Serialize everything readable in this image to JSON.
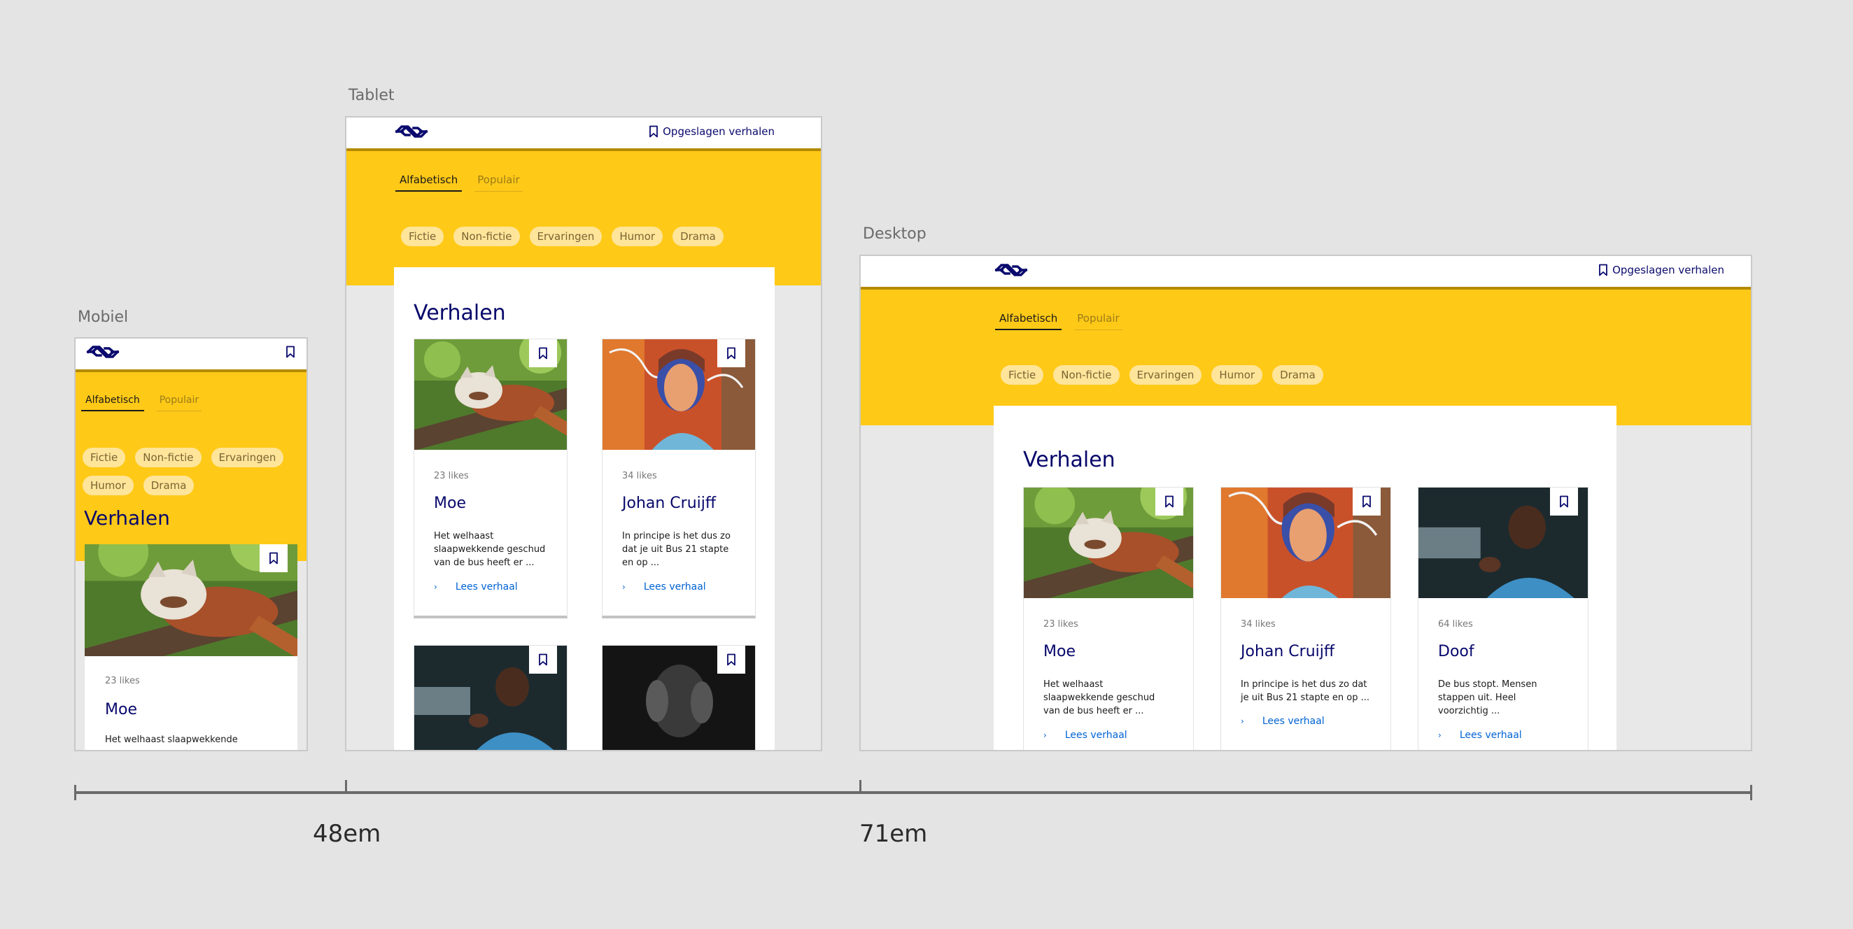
{
  "frames": {
    "mobile": {
      "label": "Mobiel"
    },
    "tablet": {
      "label": "Tablet"
    },
    "desktop": {
      "label": "Desktop"
    }
  },
  "header": {
    "saved_label": "Opgeslagen verhalen"
  },
  "tabs": {
    "alphabetical": "Alfabetisch",
    "popular": "Populair"
  },
  "filters": [
    "Fictie",
    "Non-fictie",
    "Ervaringen",
    "Humor",
    "Drama"
  ],
  "heading": "Verhalen",
  "stories": [
    {
      "likes": "23 likes",
      "title": "Moe",
      "excerpt": "Het welhaast slaapwekkende geschud van de bus heeft er ...",
      "image": "red panda sleeping on a branch"
    },
    {
      "likes": "34 likes",
      "title": "Johan Cruijff",
      "excerpt": "In principe is het dus zo dat je uit Bus 21 stapte en op ...",
      "image": "mural portrait of Johan Cruijff"
    },
    {
      "likes": "64 likes",
      "title": "Doof",
      "excerpt": "De bus stopt. Mensen stappen uit. Heel voorzichtig ...",
      "image": "man in blue shirt using sign language"
    },
    {
      "image": "black and white photo of person holding head"
    }
  ],
  "mobile_excerpt": "Het welhaast slaapwekkende",
  "read_more": "Lees verhaal",
  "ruler": {
    "tablet": "48em",
    "desktop": "71em"
  },
  "icons": {
    "logo": "ns-logo-icon",
    "bookmark": "bookmark-icon",
    "chevron": "chevron-right-icon"
  },
  "colors": {
    "brand_yellow": "#ffc917",
    "brand_blue": "#07076b",
    "link": "#0063d3"
  }
}
